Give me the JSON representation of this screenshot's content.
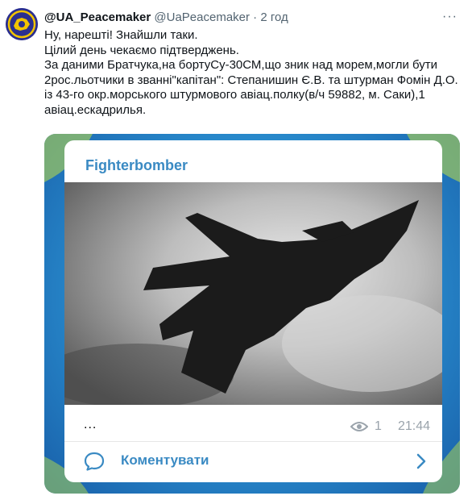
{
  "tweet": {
    "display_name": "@UA_Peacemaker",
    "handle": "@UaPeacemaker",
    "separator": "·",
    "time": "2 год",
    "more_label": "···",
    "lines": [
      "Ну, нарешті! Знайшли таки.",
      "Цілий день чекаємо підтверджень.",
      "За даними Братчука,на бортуСу-30СМ,що зник над морем,могли бути 2рос.льотчики в званні\"капітан\": Степанишин Є.В. та штурман Фомін Д.О. із 43-го окр.морського штурмового авіац.полку(в/ч 59882, м. Саки),1 авіац.ескадрилья."
    ]
  },
  "card": {
    "channel": "Fighterbomber",
    "dots": "...",
    "views": "1",
    "time": "21:44",
    "comment_label": "Коментувати"
  },
  "colors": {
    "accent": "#3a8ac3",
    "muted": "#536471",
    "media_bg": "#2a8fd0"
  },
  "icons": [
    "avatar-logo",
    "eye-icon",
    "comment-bubble-icon",
    "chevron-right-icon",
    "more-icon"
  ]
}
